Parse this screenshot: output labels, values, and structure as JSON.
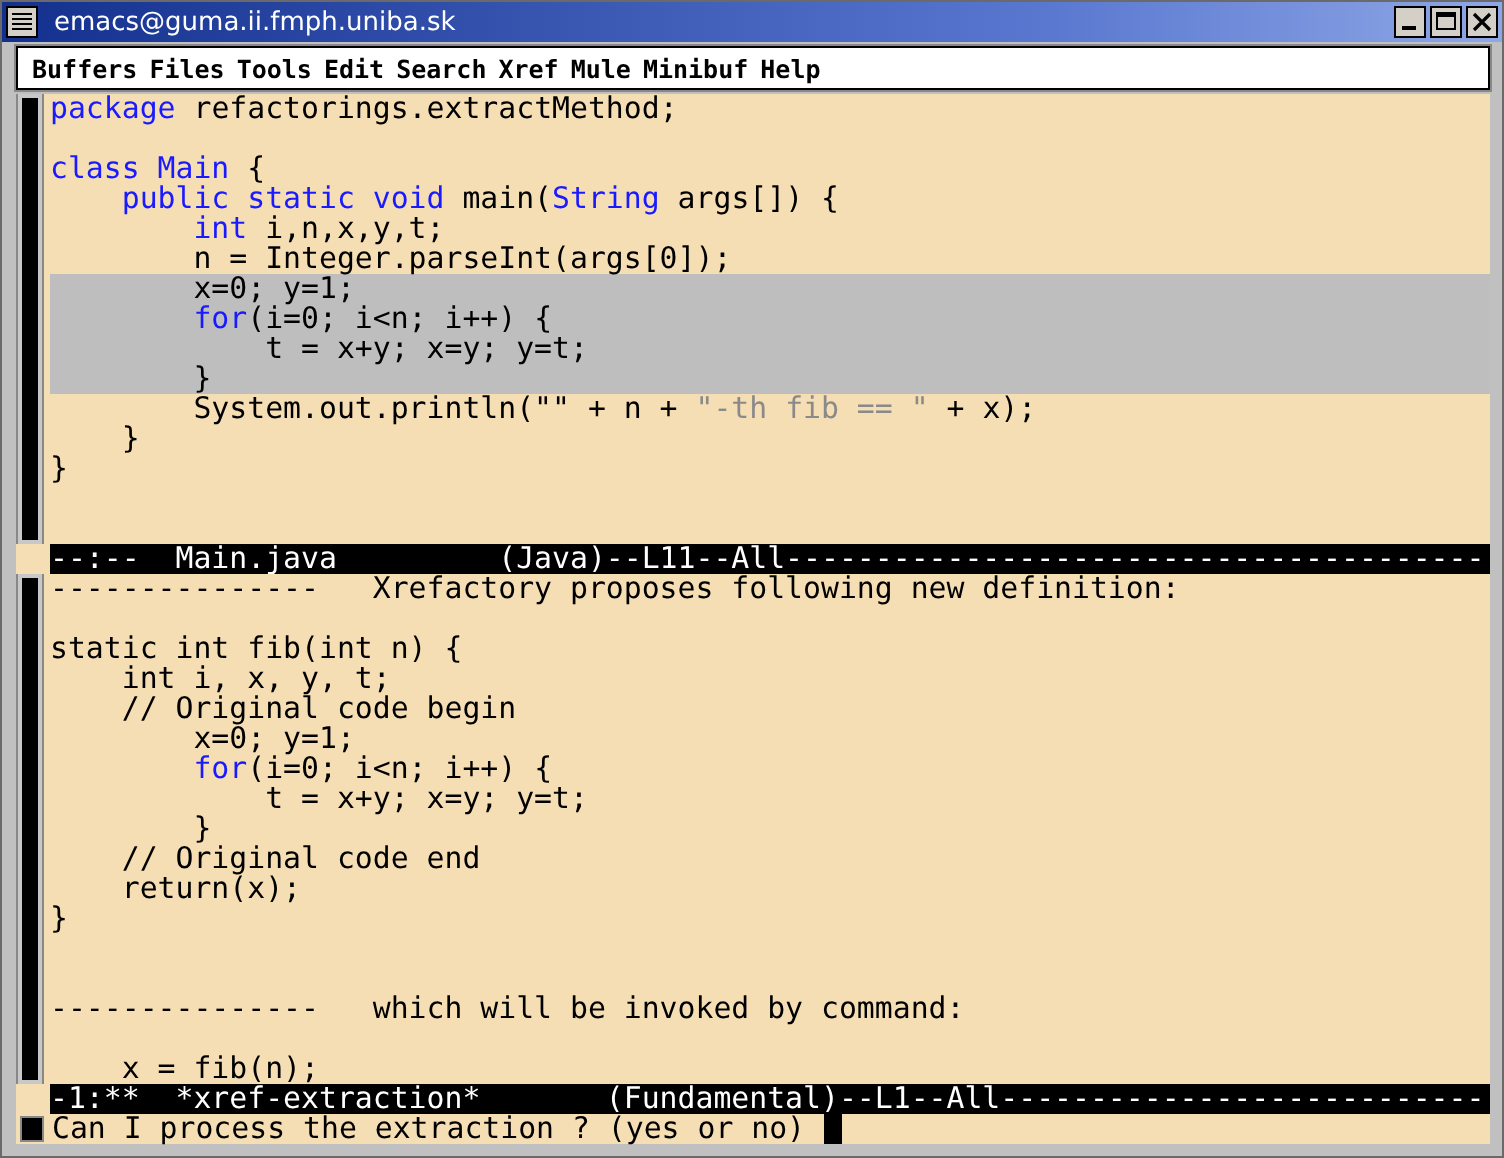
{
  "window": {
    "title": "emacs@guma.ii.fmph.uniba.sk"
  },
  "menu_bar": [
    "Buffers",
    "Files",
    "Tools",
    "Edit",
    "Search",
    "Xref",
    "Mule",
    "Minibuf",
    "Help"
  ],
  "panes": [
    {
      "lines": [
        {
          "highlighted": false,
          "segments": [
            {
              "kind": "keyword",
              "text": "package"
            },
            {
              "kind": "plain",
              "text": " refactorings.extractMethod;"
            }
          ]
        },
        {
          "highlighted": false
        },
        {
          "highlighted": false,
          "segments": [
            {
              "kind": "keyword",
              "text": "class Main"
            },
            {
              "kind": "plain",
              "text": " {"
            }
          ]
        },
        {
          "highlighted": false,
          "segments": [
            {
              "kind": "keyword",
              "text": "    public static void"
            },
            {
              "kind": "plain",
              "text": " main("
            },
            {
              "kind": "keyword",
              "text": "String"
            },
            {
              "kind": "plain",
              "text": " args[]) {"
            }
          ]
        },
        {
          "highlighted": false,
          "segments": [
            {
              "kind": "keyword",
              "text": "        int"
            },
            {
              "kind": "plain",
              "text": " i,n,x,y,t;"
            }
          ]
        },
        {
          "highlighted": false,
          "segments": [
            {
              "kind": "plain",
              "text": "        n = Integer.parseInt(args[0]);"
            }
          ]
        },
        {
          "highlighted": true,
          "segments": [
            {
              "kind": "plain",
              "text": "        x=0; y=1;"
            }
          ]
        },
        {
          "highlighted": true,
          "segments": [
            {
              "kind": "keyword",
              "text": "        for"
            },
            {
              "kind": "plain",
              "text": "(i=0; i<n; i++) {"
            }
          ]
        },
        {
          "highlighted": true,
          "segments": [
            {
              "kind": "plain",
              "text": "            t = x+y; x=y; y=t;"
            }
          ]
        },
        {
          "highlighted": true,
          "segments": [
            {
              "kind": "plain",
              "text": "        }"
            }
          ]
        },
        {
          "highlighted": false,
          "segments": [
            {
              "kind": "plain",
              "text": "        System.out.println(\"\" + n + "
            },
            {
              "kind": "string",
              "text": "\"-th fib == \""
            },
            {
              "kind": "plain",
              "text": " + x);"
            }
          ]
        },
        {
          "highlighted": false,
          "segments": [
            {
              "kind": "plain",
              "text": "    }"
            }
          ]
        },
        {
          "highlighted": false,
          "segments": [
            {
              "kind": "plain",
              "text": "}"
            }
          ]
        }
      ],
      "mode_line": "--:--  Main.java         (Java)--L11--All---------------------------------------"
    },
    {
      "lines": [
        {
          "highlighted": false,
          "segments": [
            {
              "kind": "plain",
              "text": "---------------   Xrefactory proposes following new definition:"
            }
          ]
        },
        {
          "highlighted": false
        },
        {
          "highlighted": false,
          "segments": [
            {
              "kind": "plain",
              "text": "static int fib(int n) {"
            }
          ]
        },
        {
          "highlighted": false,
          "segments": [
            {
              "kind": "plain",
              "text": "    int i, x, y, t;"
            }
          ]
        },
        {
          "highlighted": false,
          "segments": [
            {
              "kind": "plain",
              "text": "    // Original code begin"
            }
          ]
        },
        {
          "highlighted": false,
          "segments": [
            {
              "kind": "plain",
              "text": "        x=0; y=1;"
            }
          ]
        },
        {
          "highlighted": false,
          "segments": [
            {
              "kind": "keyword",
              "text": "        for"
            },
            {
              "kind": "plain",
              "text": "(i=0; i<n; i++) {"
            }
          ]
        },
        {
          "highlighted": false,
          "segments": [
            {
              "kind": "plain",
              "text": "            t = x+y; x=y; y=t;"
            }
          ]
        },
        {
          "highlighted": false,
          "segments": [
            {
              "kind": "plain",
              "text": "        }"
            }
          ]
        },
        {
          "highlighted": false,
          "segments": [
            {
              "kind": "plain",
              "text": "    // Original code end"
            }
          ]
        },
        {
          "highlighted": false,
          "segments": [
            {
              "kind": "plain",
              "text": "    return(x);"
            }
          ]
        },
        {
          "highlighted": false,
          "segments": [
            {
              "kind": "plain",
              "text": "}"
            }
          ]
        },
        {
          "highlighted": false
        },
        {
          "highlighted": false
        },
        {
          "highlighted": false,
          "segments": [
            {
              "kind": "plain",
              "text": "---------------   which will be invoked by command:"
            }
          ]
        },
        {
          "highlighted": false
        },
        {
          "highlighted": false,
          "segments": [
            {
              "kind": "plain",
              "text": "    x = fib(n);"
            }
          ]
        }
      ],
      "mode_line": "-1:**  *xref-extraction*       (Fundamental)--L1--All---------------------------"
    }
  ],
  "minibuffer": {
    "prompt": "Can I process the extraction ? (yes or no) "
  }
}
